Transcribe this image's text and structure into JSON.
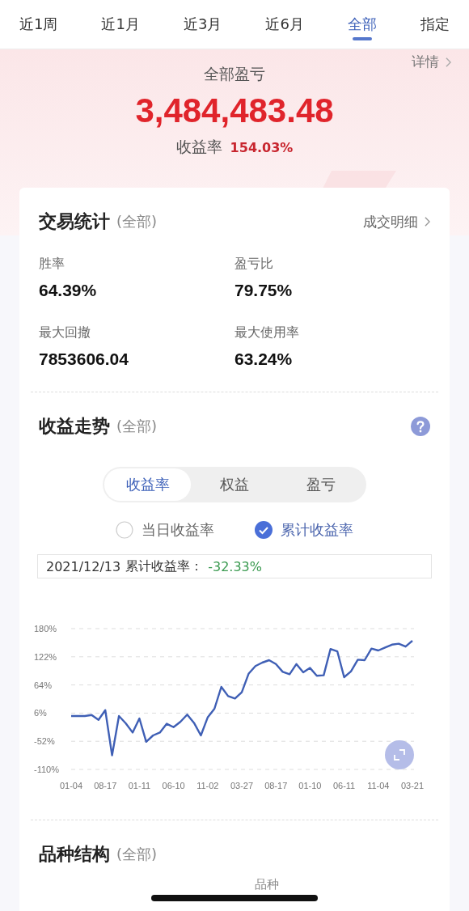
{
  "tabs": [
    {
      "label": "近1周",
      "selected": false
    },
    {
      "label": "近1月",
      "selected": false
    },
    {
      "label": "近3月",
      "selected": false
    },
    {
      "label": "近6月",
      "selected": false
    },
    {
      "label": "全部",
      "selected": true
    },
    {
      "label": "指定",
      "selected": false
    }
  ],
  "summary": {
    "detail_link": "详情",
    "title": "全部盈亏",
    "amount": "3,484,483.48",
    "rate_label": "收益率",
    "rate_value": "154.03%"
  },
  "trade_stats": {
    "title": "交易统计",
    "scope": "(全部)",
    "link": "成交明细",
    "stats": [
      {
        "label": "胜率",
        "value": "64.39%"
      },
      {
        "label": "盈亏比",
        "value": "79.75%"
      },
      {
        "label": "最大回撤",
        "value": "7853606.04"
      },
      {
        "label": "最大使用率",
        "value": "63.24%"
      }
    ]
  },
  "return_trend": {
    "title": "收益走势",
    "scope": "(全部)",
    "segments": [
      {
        "label": "收益率",
        "selected": true
      },
      {
        "label": "权益",
        "selected": false
      },
      {
        "label": "盈亏",
        "selected": false
      }
    ],
    "options": [
      {
        "label": "当日收益率",
        "checked": false
      },
      {
        "label": "累计收益率",
        "checked": true
      }
    ],
    "tooltip": {
      "date": "2021/12/13",
      "label": "累计收益率：",
      "value": "-32.33%"
    },
    "chart_data": {
      "type": "line",
      "grid": true,
      "ylim": [
        -110,
        180
      ],
      "yticks": [
        {
          "value": 180,
          "label": "180%"
        },
        {
          "value": 122,
          "label": "122%"
        },
        {
          "value": 64,
          "label": "64%"
        },
        {
          "value": 6,
          "label": "6%"
        },
        {
          "value": -52,
          "label": "-52%"
        },
        {
          "value": -110,
          "label": "-110%"
        }
      ],
      "categories": [
        "01-04",
        null,
        null,
        null,
        null,
        "08-17",
        null,
        null,
        null,
        null,
        "01-11",
        null,
        null,
        null,
        null,
        "06-10",
        null,
        null,
        null,
        null,
        "11-02",
        null,
        null,
        null,
        null,
        "03-27",
        null,
        null,
        null,
        null,
        "08-17",
        null,
        null,
        null,
        null,
        "01-10",
        null,
        null,
        null,
        null,
        "06-11",
        null,
        null,
        null,
        null,
        "11-04",
        null,
        null,
        null,
        null,
        "03-21"
      ],
      "series": [
        {
          "color": "#3f5fb5",
          "values": [
            0,
            0,
            0,
            2,
            -8,
            12,
            -81,
            0,
            -15,
            -34,
            -5,
            -53,
            -40,
            -34,
            -16,
            -23,
            -12,
            3,
            -14,
            -40,
            -3,
            15,
            60,
            41,
            36,
            49,
            87,
            103,
            110,
            115,
            107,
            91,
            86,
            107,
            90,
            99,
            83,
            84,
            138,
            133,
            80,
            92,
            116,
            115,
            139,
            135,
            141,
            147,
            149,
            143,
            155
          ]
        }
      ]
    }
  },
  "variety_structure": {
    "title": "品种结构",
    "scope": "(全部)",
    "column_1": "品种"
  }
}
